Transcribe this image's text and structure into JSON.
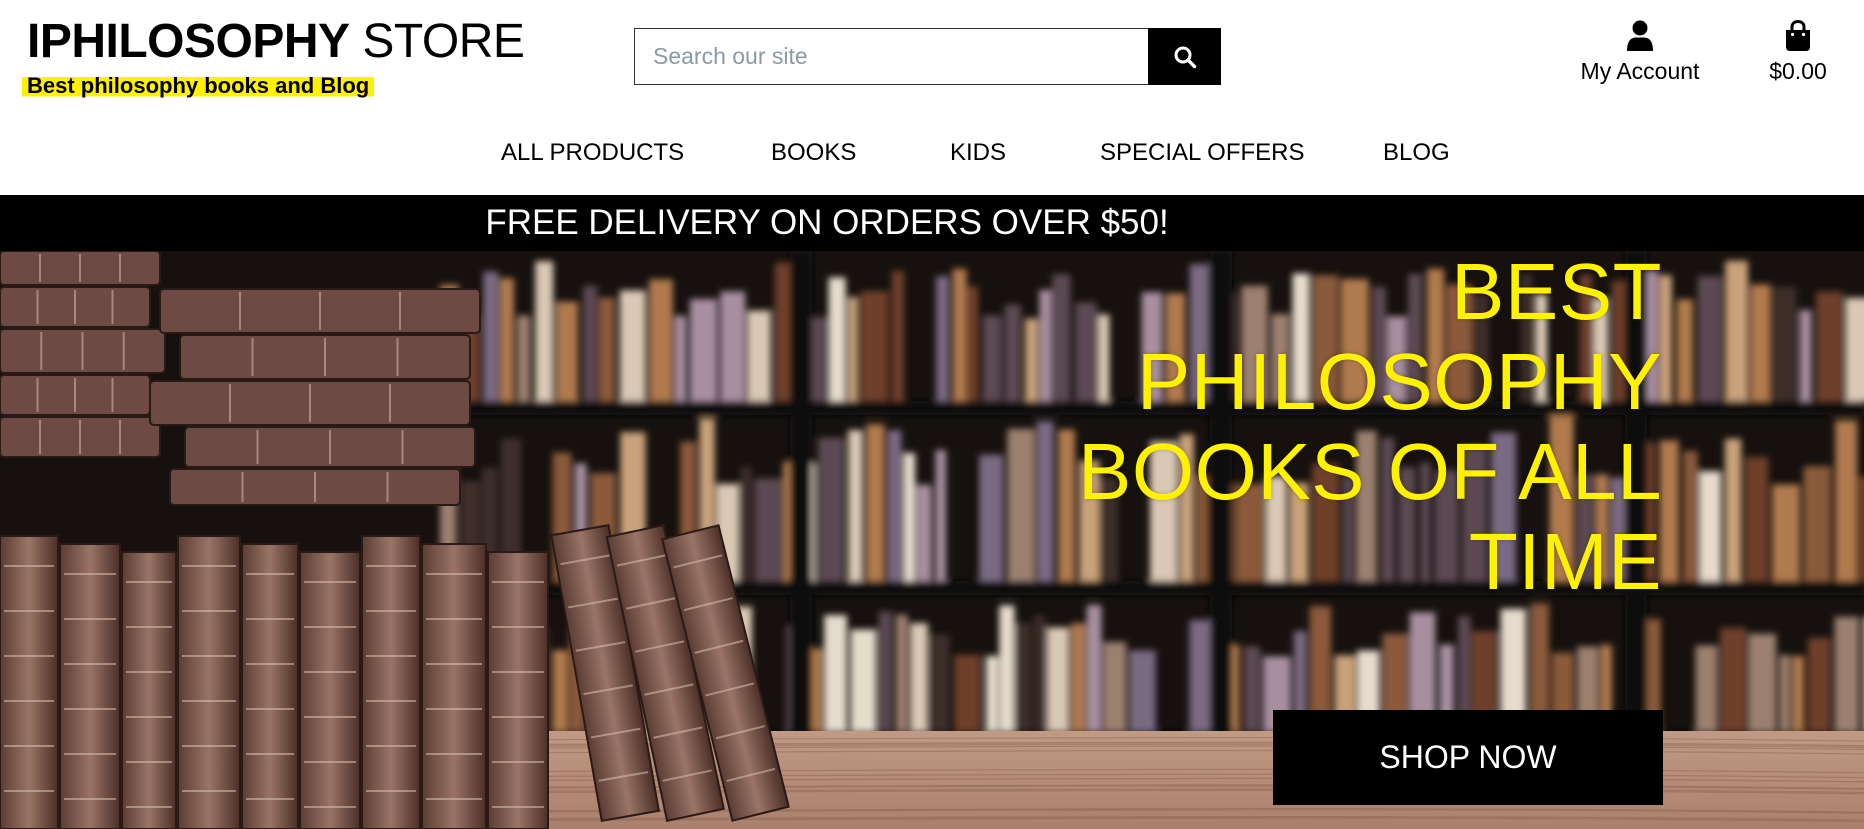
{
  "brand": {
    "title_strong": "IPHILOSOPHY",
    "title_light": "STORE",
    "tagline": "Best philosophy books and Blog",
    "highlight_color": "#fff200"
  },
  "search": {
    "placeholder": "Search our site",
    "value": "",
    "icon": "search-icon"
  },
  "account": {
    "label": "My Account",
    "icon": "user-icon"
  },
  "bag": {
    "label": "$0.00",
    "icon": "shopping-bag-icon"
  },
  "nav": {
    "items": [
      {
        "label": "ALL PRODUCTS"
      },
      {
        "label": "BOOKS"
      },
      {
        "label": "KIDS"
      },
      {
        "label": "SPECIAL OFFERS"
      },
      {
        "label": "BLOG"
      }
    ]
  },
  "banner": {
    "text": "FREE DELIVERY ON ORDERS OVER $50!"
  },
  "hero": {
    "heading": "BEST PHILOSOPHY BOOKS OF ALL TIME",
    "cta_label": "SHOP NOW",
    "heading_color": "#fff200"
  }
}
